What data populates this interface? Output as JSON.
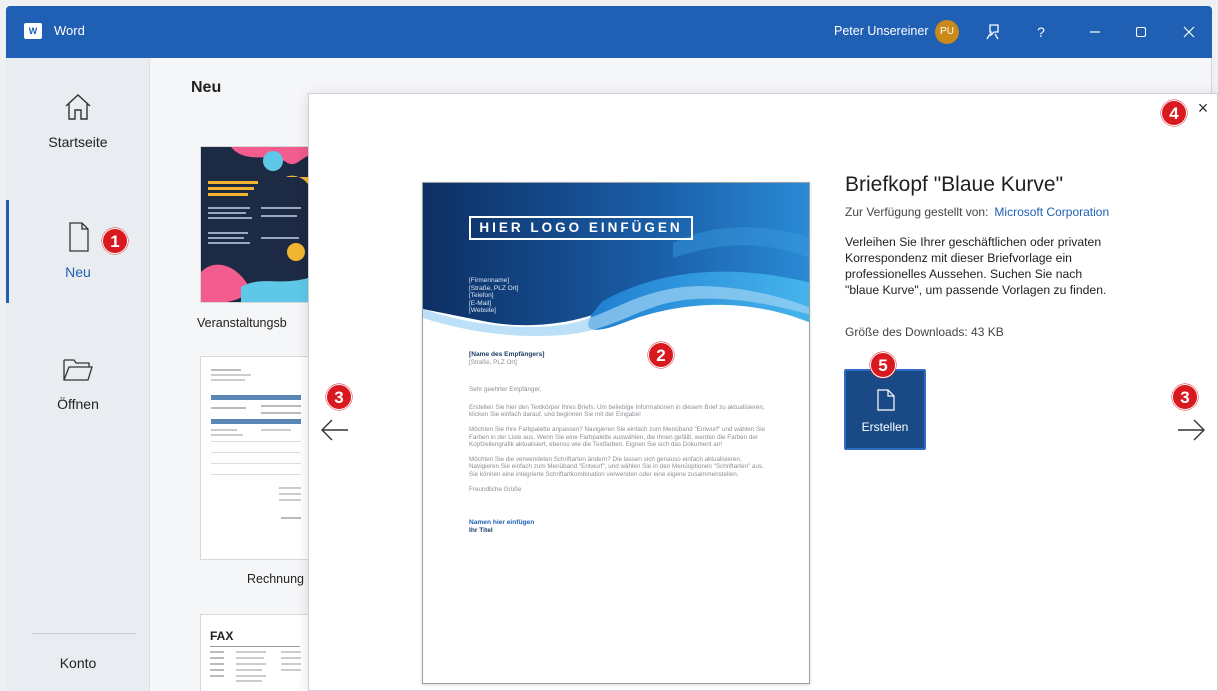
{
  "titlebar": {
    "app_icon": "W",
    "app_title": "Word",
    "user_name": "Peter Unsereiner",
    "avatar_initials": "PU",
    "help_label": "?",
    "accent_color": "#1f5fb4"
  },
  "nav": {
    "home_label": "Startseite",
    "new_label": "Neu",
    "open_label": "Öffnen",
    "account_label": "Konto"
  },
  "main": {
    "heading": "Neu",
    "templates": [
      {
        "label": "Veranstaltungsb"
      },
      {
        "label": "Rechnung ("
      },
      {
        "label": ""
      }
    ],
    "fax_title": "FAX"
  },
  "modal": {
    "title": "Briefkopf \"Blaue Kurve\"",
    "provider_label": "Zur Verfügung gestellt von:",
    "provider_name": "Microsoft Corporation",
    "description": "Verleihen Sie Ihrer geschäftlichen oder privaten Korrespondenz mit dieser Briefvorlage ein professionelles Aussehen. Suchen Sie nach \"blaue Kurve\", um passende Vorlagen zu finden.",
    "download_size": "Größe des Downloads:  43 KB",
    "create_label": "Erstellen",
    "close_symbol": "×"
  },
  "preview": {
    "logo_text": "HIER LOGO EINFÜGEN",
    "header_lines": [
      "[Firmenname]",
      "[Straße, PLZ Ort]",
      "[Telefon]",
      "[E-Mail]",
      "[Website]"
    ],
    "recipient_name": "[Name des Empfängers]",
    "recipient_address": "[Straße, PLZ Ort]",
    "salutation": "Sehr geehrter Empfänger,",
    "paragraph_1": "Erstellen Sie hier den Textkörper Ihres Briefs. Um beliebige Informationen in diesem Brief zu aktualisieren, klicken Sie einfach darauf, und beginnen Sie mit der Eingabe!",
    "paragraph_2": "Möchten Sie Ihre Farbpalette anpassen? Navigieren Sie einfach zum Menüband \"Entwurf\" und wählen Sie Farben in der Liste aus. Wenn Sie eine Farbpalette auswählen, die Ihnen gefällt, werden die Farben der Kopfzeilengrafik aktualisiert, ebenso wie die Textfarben. Eignen Sie sich das Dokument an!",
    "paragraph_3": "Möchten Sie die verwendeten Schriftarten ändern? Die lassen sich genauso einfach aktualisieren. Navigieren Sie einfach zum Menüband \"Entwurf\", und wählen Sie in den Menüoptionen \"Schriftarten\" aus. Sie können eine integrierte Schriftartkombination verwenden oder eine eigene zusammenstellen.",
    "closing": "Freundliche Grüße",
    "sender_name": "Namen hier einfügen",
    "sender_title": "Ihr Titel"
  },
  "badges": {
    "nav_new": "1",
    "preview": "2",
    "prev": "3",
    "next": "3",
    "close": "4",
    "create": "5"
  }
}
